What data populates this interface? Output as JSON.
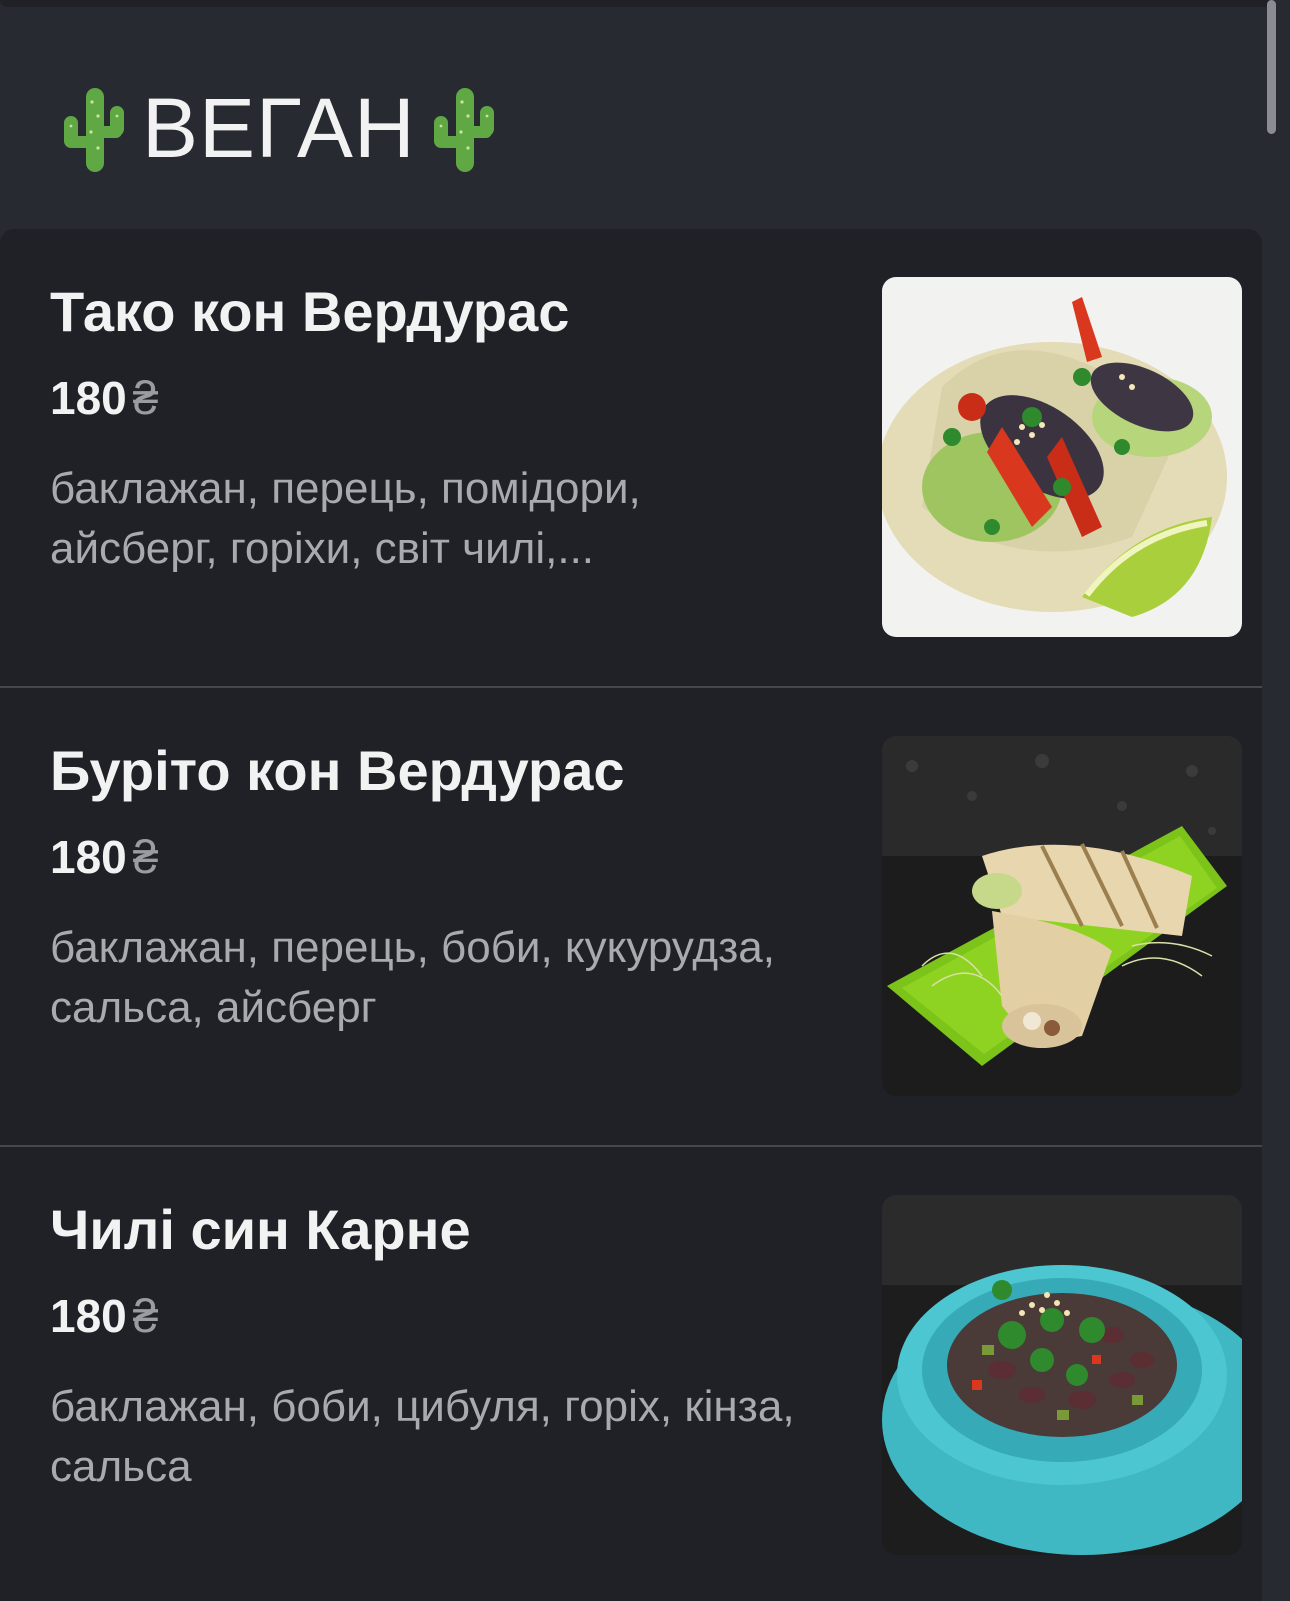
{
  "section": {
    "title": "ВЕГАН",
    "left_icon": "cactus-icon",
    "right_icon": "cactus-icon"
  },
  "items": [
    {
      "name": "Тако кон Вердурас",
      "price": "180",
      "currency": "₴",
      "description": "баклажан, перець, помідори, айсберг, горіхи, світ чилі,..."
    },
    {
      "name": "Буріто кон Вердурас",
      "price": "180",
      "currency": "₴",
      "description": "баклажан, перець, боби, кукурудза, сальса, айсберг"
    },
    {
      "name": "Чилі син Карне",
      "price": "180",
      "currency": "₴",
      "description": "баклажан, боби, цибуля, горіх, кінза, сальса"
    }
  ]
}
